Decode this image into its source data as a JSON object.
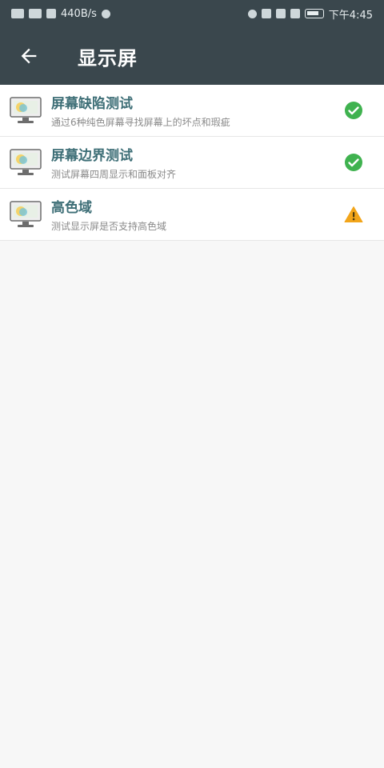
{
  "status_bar": {
    "speed": "440B/s",
    "time": "下午4:45"
  },
  "toolbar": {
    "back_icon": "arrow-left-icon",
    "title": "显示屏"
  },
  "items": [
    {
      "title": "屏幕缺陷测试",
      "subtitle": "通过6种纯色屏幕寻找屏幕上的坏点和瑕疵",
      "status": "passed",
      "status_icon": "check-circle-icon",
      "status_color": "#3fb24f"
    },
    {
      "title": "屏幕边界测试",
      "subtitle": "测试屏幕四周显示和面板对齐",
      "status": "passed",
      "status_icon": "check-circle-icon",
      "status_color": "#3fb24f"
    },
    {
      "title": "高色域",
      "subtitle": "测试显示屏是否支持高色域",
      "status": "warning",
      "status_icon": "warning-triangle-icon",
      "status_color": "#f2a51a"
    }
  ],
  "colors": {
    "header_bg": "#3a474d",
    "title_text": "#3d6e76"
  }
}
